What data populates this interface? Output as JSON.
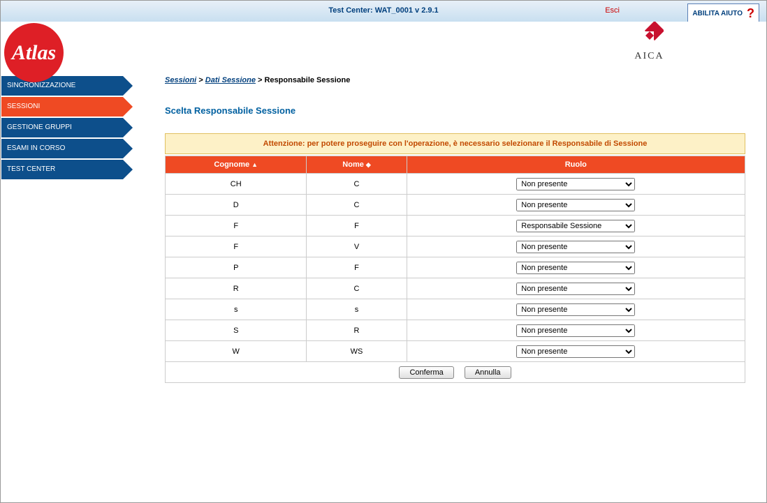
{
  "header": {
    "title": "Test Center: WAT_0001 v 2.9.1",
    "logo_text": "Atlas",
    "esci": "Esci",
    "aica": "AICA",
    "help": "ABILITA AIUTO"
  },
  "sidebar": {
    "items": [
      {
        "label": "SINCRONIZZAZIONE",
        "active": false
      },
      {
        "label": "SESSIONI",
        "active": true
      },
      {
        "label": "GESTIONE GRUPPI",
        "active": false
      },
      {
        "label": "ESAMI IN CORSO",
        "active": false
      },
      {
        "label": "TEST CENTER",
        "active": false
      }
    ]
  },
  "breadcrumb": {
    "items": [
      "Sessioni",
      "Dati Sessione"
    ],
    "current": "Responsabile Sessione"
  },
  "page_title": "Scelta Responsabile Sessione",
  "warning": "Attenzione: per potere proseguire con l'operazione, è necessario selezionare il Responsabile di Sessione",
  "table": {
    "headers": {
      "cognome": "Cognome",
      "nome": "Nome",
      "ruolo": "Ruolo"
    },
    "role_options": [
      "Non presente",
      "Responsabile Sessione"
    ],
    "rows": [
      {
        "cognome": "CH",
        "nome": "C",
        "ruolo": "Non presente"
      },
      {
        "cognome": "D",
        "nome": "C",
        "ruolo": "Non presente"
      },
      {
        "cognome": "F",
        "nome": "F",
        "ruolo": "Responsabile Sessione"
      },
      {
        "cognome": "F",
        "nome": "V",
        "ruolo": "Non presente"
      },
      {
        "cognome": "P",
        "nome": "F",
        "ruolo": "Non presente"
      },
      {
        "cognome": "R",
        "nome": "C",
        "ruolo": "Non presente"
      },
      {
        "cognome": "s",
        "nome": "s",
        "ruolo": "Non presente"
      },
      {
        "cognome": "S",
        "nome": "R",
        "ruolo": "Non presente"
      },
      {
        "cognome": "W",
        "nome": "WS",
        "ruolo": "Non presente"
      }
    ]
  },
  "buttons": {
    "confirm": "Conferma",
    "cancel": "Annulla"
  }
}
